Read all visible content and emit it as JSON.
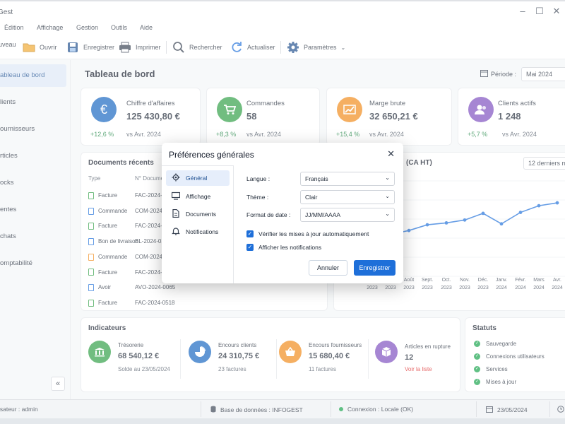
{
  "app": {
    "title": "Gest"
  },
  "menu": [
    "Édition",
    "Affichage",
    "Gestion",
    "Outils",
    "Aide"
  ],
  "toolbar": {
    "nouveau": "uveau",
    "ouvrir": "Ouvrir",
    "enregistrer": "Enregistrer",
    "imprimer": "Imprimer",
    "rechercher": "Rechercher",
    "actualiser": "Actualiser",
    "parametres": "Paramètres"
  },
  "sidebar": {
    "items": [
      {
        "label": "ableau de bord",
        "active": true
      },
      {
        "label": "lients"
      },
      {
        "label": "ournisseurs"
      },
      {
        "label": "rticles"
      },
      {
        "label": "ocks"
      },
      {
        "label": "entes"
      },
      {
        "label": "chats"
      },
      {
        "label": "omptabilité"
      }
    ],
    "collapse": "«"
  },
  "main": {
    "title": "Tableau de bord",
    "periode_label": "Période :",
    "periode_value": "Mai 2024"
  },
  "kpis": [
    {
      "label": "Chiffre d'affaires",
      "value": "125 430,80 €",
      "change": "+12,6 %",
      "compare": "vs Avr. 2024",
      "color": "#1565c0",
      "icon": "euro-icon"
    },
    {
      "label": "Commandes",
      "value": "58",
      "change": "+8,3 %",
      "compare": "vs Avr. 2024",
      "color": "#2e9e44",
      "icon": "cart-icon"
    },
    {
      "label": "Marge brute",
      "value": "32 650,21 €",
      "change": "+15,4 %",
      "compare": "vs Avr. 2024",
      "color": "#f08a18",
      "icon": "chart-growth-icon"
    },
    {
      "label": "Clients actifs",
      "value": "1 248",
      "change": "+5,7 %",
      "compare": "vs Avr. 2024",
      "color": "#7c4dbe",
      "icon": "users-icon"
    }
  ],
  "documents": {
    "title": "Documents récents",
    "headers": [
      "Type",
      "N° Documen"
    ],
    "rows": [
      {
        "type": "Facture",
        "num": "FAC-2024-0",
        "color": "#2e9e44"
      },
      {
        "type": "Commande",
        "num": "COM-2024-0",
        "color": "#1e6fd9"
      },
      {
        "type": "Facture",
        "num": "FAC-2024-0",
        "color": "#2e9e44"
      },
      {
        "type": "Bon de livraison",
        "num": "BL-2024-03",
        "color": "#1e6fd9"
      },
      {
        "type": "Commande",
        "num": "COM-2024-0",
        "color": "#f08a18"
      },
      {
        "type": "Facture",
        "num": "FAC-2024-0",
        "color": "#2e9e44"
      },
      {
        "type": "Avoir",
        "num": "AVO-2024-0065",
        "color": "#1e6fd9"
      },
      {
        "type": "Facture",
        "num": "FAC-2024-0518",
        "color": "#2e9e44"
      }
    ]
  },
  "chart": {
    "title_fragment": "(CA HT)",
    "range": "12 derniers m"
  },
  "chart_data": {
    "type": "line",
    "title": "(CA HT)",
    "categories": [
      "Août 2023",
      "Sept. 2023",
      "Oct. 2023",
      "Nov. 2023",
      "Déc. 2023",
      "Janv. 2024",
      "Févr. 2024",
      "Mars 2024",
      "Avr. 2024"
    ],
    "x_labels_top": [
      "",
      "",
      "Août",
      "Sept.",
      "Oct.",
      "Nov.",
      "Déc.",
      "Janv.",
      "Févr.",
      "Mars",
      "Avr."
    ],
    "x_labels_bottom": [
      "2023",
      "2023",
      "2023",
      "2023",
      "2023",
      "2023",
      "2023",
      "2024",
      "2024",
      "2024",
      "2024"
    ],
    "values": [
      108,
      114,
      116,
      119,
      126,
      115,
      127,
      134,
      137
    ],
    "hidden_values": [
      102,
      104
    ],
    "ylim": [
      60,
      160
    ],
    "color": "#1e6fd9"
  },
  "indicators": {
    "title": "Indicateurs",
    "items": [
      {
        "label": "Trésorerie",
        "value": "68 540,12 €",
        "sub": "Solde au 23/05/2024",
        "color": "#2e9e44",
        "icon": "bank-icon"
      },
      {
        "label": "Encours clients",
        "value": "24 310,75 €",
        "sub": "23 factures",
        "color": "#1565c0",
        "icon": "pie-chart-icon"
      },
      {
        "label": "Encours fournisseurs",
        "value": "15 680,40 €",
        "sub": "11 factures",
        "color": "#f08a18",
        "icon": "basket-icon"
      },
      {
        "label": "Articles en rupture",
        "value": "12",
        "sub": "Voir la liste",
        "color": "#7c4dbe",
        "icon": "box-icon",
        "sub_color": "#dc2626"
      }
    ]
  },
  "status": {
    "title": "Statuts",
    "items": [
      "Sauvegarde",
      "Connexions utilisateurs",
      "Services",
      "Mises à jour"
    ]
  },
  "statusbar": {
    "user": "isateur : admin",
    "db": "Base de données : INFOGEST",
    "connection": "Connexion : Locale (OK)",
    "date": "23/05/2024"
  },
  "modal": {
    "title": "Préférences générales",
    "nav": [
      {
        "label": "Général",
        "icon": "gear-icon",
        "active": true
      },
      {
        "label": "Affichage",
        "icon": "monitor-icon"
      },
      {
        "label": "Documents",
        "icon": "document-icon"
      },
      {
        "label": "Notifications",
        "icon": "bell-icon"
      }
    ],
    "fields": [
      {
        "label": "Langue :",
        "value": "Français"
      },
      {
        "label": "Thème :",
        "value": "Clair"
      },
      {
        "label": "Format de date :",
        "value": "JJ/MM/AAAA"
      }
    ],
    "checks": [
      "Vérifier les mises à jour automatiquement",
      "Afficher les notifications"
    ],
    "cancel": "Annuler",
    "save": "Enregistrer"
  }
}
